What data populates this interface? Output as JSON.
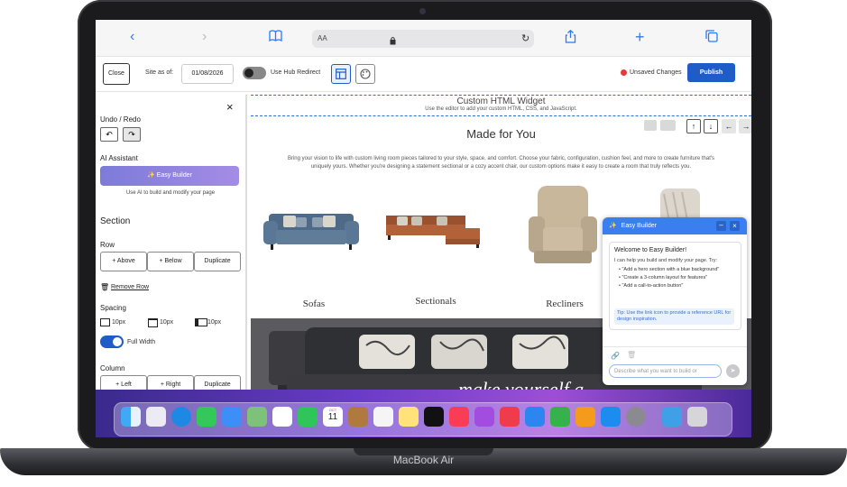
{
  "device": {
    "label": "MacBook Air"
  },
  "safari": {
    "url_prefix": "AA"
  },
  "toolbar": {
    "close_label": "Close",
    "site_as_of_label": "Site as of:",
    "date_value": "01/08/2026",
    "hub_redirect_label": "Use Hub Redirect",
    "unsaved_label": "Unsaved Changes",
    "publish_label": "Publish"
  },
  "sidebar": {
    "undo_redo_title": "Undo / Redo",
    "ai_title": "AI Assistant",
    "easy_builder_label": "Easy Builder",
    "ai_hint": "Use AI to build and modify your page",
    "section_title": "Section",
    "row_title": "Row",
    "row_buttons": [
      "+ Above",
      "+ Below",
      "Duplicate"
    ],
    "remove_row": "Remove Row",
    "spacing_title": "Spacing",
    "spacing_values": [
      "10px",
      "10px",
      "10px"
    ],
    "full_width_label": "Full Width",
    "column_title": "Column",
    "column_buttons": [
      "+ Left",
      "+ Right",
      "Duplicate"
    ]
  },
  "canvas": {
    "widget_title": "Custom HTML Widget",
    "widget_subtitle": "Use the editor to add your custom HTML, CSS, and JavaScript.",
    "heading": "Made for You",
    "body_line1": "Bring your vision to life with custom living room pieces tailored to your style, space, and comfort. Choose your fabric, configuration, cushion feel, and more to create furniture that's",
    "body_line2": "uniquely yours. Whether you're designing a statement sectional or a cozy accent chair, our custom options make it easy to create a room that truly reflects you.",
    "categories": [
      "Sofas",
      "Sectionals",
      "Recliners"
    ],
    "banner_text": "make yourself a"
  },
  "chat": {
    "title": "Easy Builder",
    "welcome": "Welcome to Easy Builder!",
    "intro": "I can help you build and modify your page. Try:",
    "suggestions": [
      "\"Add a hero section with a blue background\"",
      "\"Create a 3-column layout for features\"",
      "\"Add a call-to-action button\""
    ],
    "tip": "Tip: Use the link icon to provide a reference URL for design inspiration.",
    "input_placeholder": "Describe what you want to build or"
  },
  "dock": {
    "calendar_month": "OCT",
    "calendar_day": "11"
  },
  "colors": {
    "accent": "#1f5cc8",
    "chat_header": "#3a7ef0",
    "unsaved_dot": "#e23b3b"
  }
}
